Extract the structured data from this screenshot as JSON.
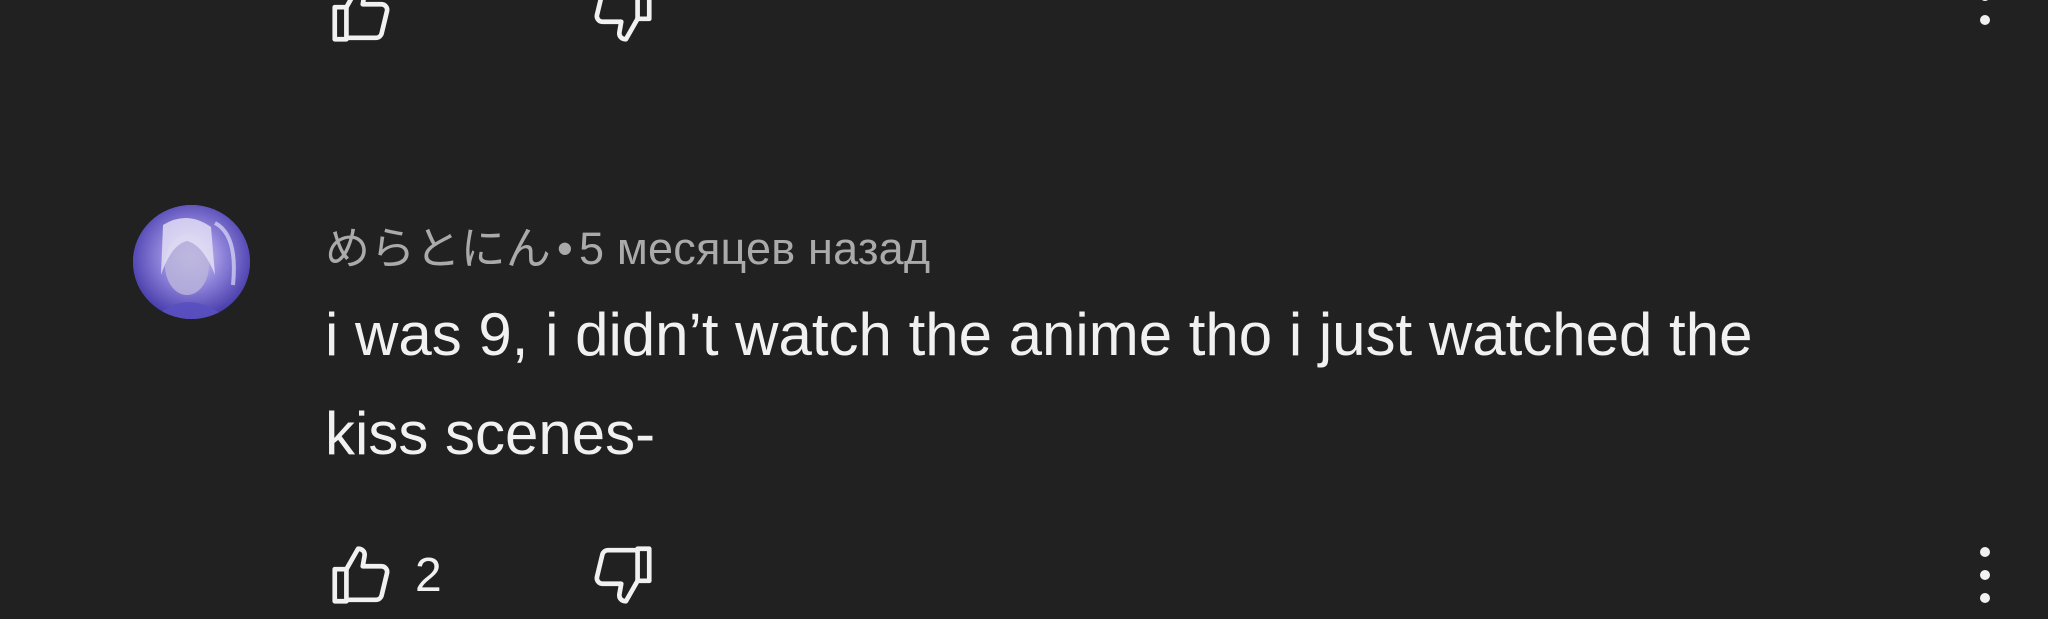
{
  "previous_comment": {
    "like_icon": "thumb-up-outline-icon",
    "dislike_icon": "thumb-down-outline-icon",
    "more_icon": "more-vertical-icon"
  },
  "comment": {
    "author": "めらとにん",
    "separator": "•",
    "timestamp": "5 месяцев назад",
    "text": "i was 9, i didn’t watch the anime tho i just watched the\nkiss scenes-",
    "like_count": "2",
    "avatar_color": "#6b5fd0"
  },
  "colors": {
    "background": "#212121",
    "text_primary": "#f1f1f1",
    "text_secondary": "#aaaaaa"
  }
}
